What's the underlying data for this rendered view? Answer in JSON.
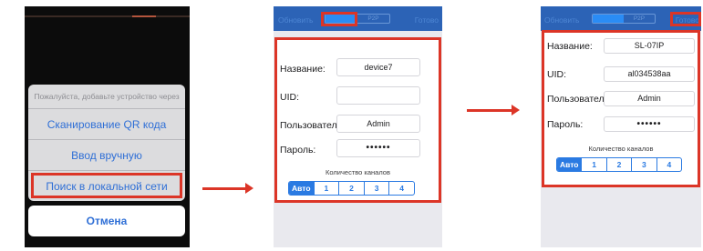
{
  "screen1": {
    "sheet_title": "Пожалуйста, добавьте устройство через",
    "options": [
      {
        "label": "Сканирование QR кода"
      },
      {
        "label": "Ввод вручную"
      },
      {
        "label": "Поиск в локальной сети"
      }
    ],
    "cancel_label": "Отмена"
  },
  "nav": {
    "refresh_label": "Обновить",
    "segments": [
      "LAN",
      "P2P"
    ],
    "done_label": "Готово"
  },
  "screen2": {
    "name_label": "Название:",
    "name_value": "device7",
    "uid_label": "UID:",
    "uid_value": "",
    "user_label": "Пользователь:",
    "user_value": "Admin",
    "password_label": "Пароль:",
    "password_value": "••••••",
    "channels_label": "Количество каналов",
    "channels": [
      "Авто",
      "1",
      "2",
      "3",
      "4"
    ],
    "channels_selected": "Авто"
  },
  "screen3": {
    "name_label": "Название:",
    "name_value": "SL-07IP",
    "uid_label": "UID:",
    "uid_value": "al034538aa",
    "user_label": "Пользователь:",
    "user_value": "Admin",
    "password_label": "Пароль:",
    "password_value": "••••••",
    "channels_label": "Количество каналов",
    "channels": [
      "Авто",
      "1",
      "2",
      "3",
      "4"
    ],
    "channels_selected": "Авто"
  },
  "colors": {
    "highlight": "#dc3527",
    "navbar": "#2c63b6",
    "accent_blue": "#2a7ae2",
    "sheet_text": "#2f6fd6"
  }
}
